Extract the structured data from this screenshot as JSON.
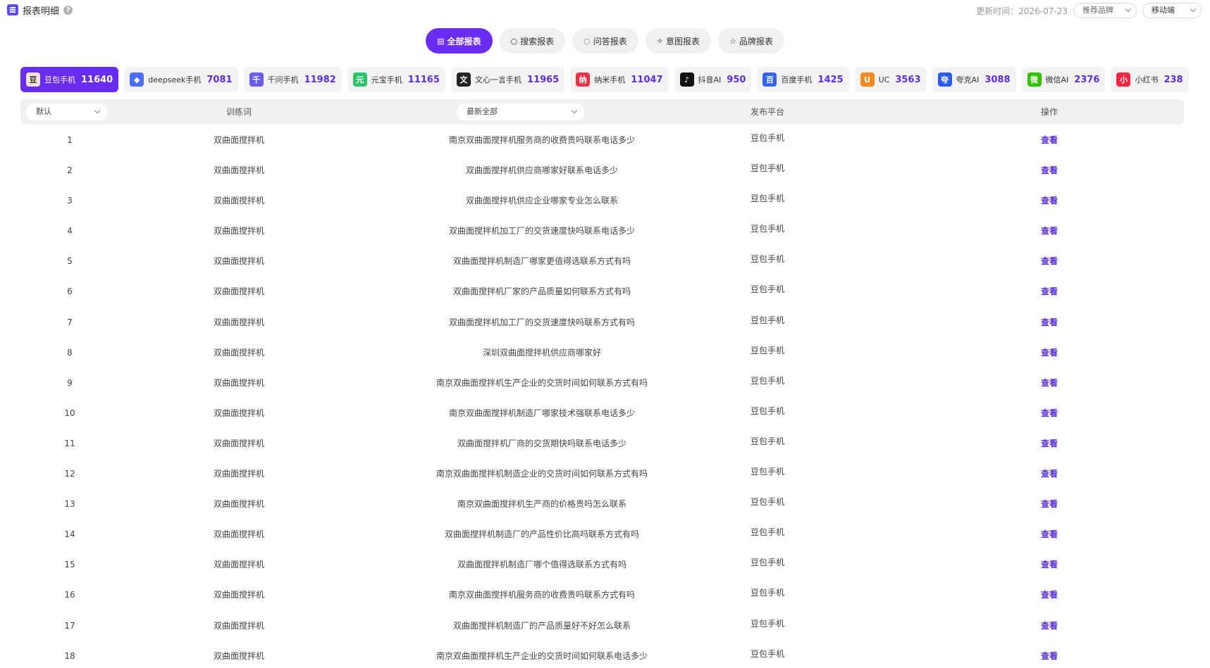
{
  "header": {
    "title": "报表明细",
    "help": "?",
    "update_time": "更新时间：2026-07-23",
    "brand_select": "推荐品牌",
    "device_select": "移动端"
  },
  "report_tabs": [
    {
      "label": "全部报表",
      "icon": "doc-icon",
      "glyph": "▤"
    },
    {
      "label": "搜索报表",
      "icon": "search-icon",
      "glyph": "○"
    },
    {
      "label": "问答报表",
      "icon": "chat-icon",
      "glyph": "◌"
    },
    {
      "label": "意图报表",
      "icon": "sparkle-icon",
      "glyph": "✧"
    },
    {
      "label": "品牌报表",
      "icon": "star-icon",
      "glyph": "☆"
    }
  ],
  "platforms": [
    {
      "name": "豆包手机",
      "count": "11640",
      "color": "#f3e6d8",
      "glyph": "豆"
    },
    {
      "name": "deepseek手机",
      "count": "7081",
      "color": "#4d6bfe",
      "glyph": "◆"
    },
    {
      "name": "千问手机",
      "count": "11982",
      "color": "#6b5cf5",
      "glyph": "千"
    },
    {
      "name": "元宝手机",
      "count": "11165",
      "color": "#2bc46b",
      "glyph": "元"
    },
    {
      "name": "文心一言手机",
      "count": "11965",
      "color": "#222222",
      "glyph": "文"
    },
    {
      "name": "纳米手机",
      "count": "11047",
      "color": "#e8334a",
      "glyph": "纳"
    },
    {
      "name": "抖音AI",
      "count": "950",
      "color": "#111111",
      "glyph": "♪"
    },
    {
      "name": "百度手机",
      "count": "1425",
      "color": "#3166f0",
      "glyph": "百"
    },
    {
      "name": "UC",
      "count": "3563",
      "color": "#f58a1f",
      "glyph": "U"
    },
    {
      "name": "夸克AI",
      "count": "3088",
      "color": "#2a5cf5",
      "glyph": "夸"
    },
    {
      "name": "微信AI",
      "count": "2376",
      "color": "#2dc100",
      "glyph": "微"
    },
    {
      "name": "小红书",
      "count": "238",
      "color": "#ff2442",
      "glyph": "小"
    }
  ],
  "table": {
    "sort_select": "默认",
    "col_word": "训练词",
    "filter_select": "最新全部",
    "col_platform": "发布平台",
    "col_action": "操作",
    "rows": [
      {
        "idx": "1",
        "word": "双曲面搅拌机",
        "question": "南京双曲面搅拌机服务商的收费贵吗联系电话多少",
        "platform": "豆包手机",
        "action": "查看"
      },
      {
        "idx": "2",
        "word": "双曲面搅拌机",
        "question": "双曲面搅拌机供应商哪家好联系电话多少",
        "platform": "豆包手机",
        "action": "查看"
      },
      {
        "idx": "3",
        "word": "双曲面搅拌机",
        "question": "双曲面搅拌机供应企业哪家专业怎么联系",
        "platform": "豆包手机",
        "action": "查看"
      },
      {
        "idx": "4",
        "word": "双曲面搅拌机",
        "question": "双曲面搅拌机加工厂的交货速度快吗联系电话多少",
        "platform": "豆包手机",
        "action": "查看"
      },
      {
        "idx": "5",
        "word": "双曲面搅拌机",
        "question": "双曲面搅拌机制造厂哪家更值得选联系方式有吗",
        "platform": "豆包手机",
        "action": "查看"
      },
      {
        "idx": "6",
        "word": "双曲面搅拌机",
        "question": "双曲面搅拌机厂家的产品质量如何联系方式有吗",
        "platform": "豆包手机",
        "action": "查看"
      },
      {
        "idx": "7",
        "word": "双曲面搅拌机",
        "question": "双曲面搅拌机加工厂的交货速度快吗联系方式有吗",
        "platform": "豆包手机",
        "action": "查看"
      },
      {
        "idx": "8",
        "word": "双曲面搅拌机",
        "question": "深圳双曲面搅拌机供应商哪家好",
        "platform": "豆包手机",
        "action": "查看"
      },
      {
        "idx": "9",
        "word": "双曲面搅拌机",
        "question": "南京双曲面搅拌机生产企业的交货时间如何联系方式有吗",
        "platform": "豆包手机",
        "action": "查看"
      },
      {
        "idx": "10",
        "word": "双曲面搅拌机",
        "question": "南京双曲面搅拌机制造厂哪家技术强联系电话多少",
        "platform": "豆包手机",
        "action": "查看"
      },
      {
        "idx": "11",
        "word": "双曲面搅拌机",
        "question": "双曲面搅拌机厂商的交货期快吗联系电话多少",
        "platform": "豆包手机",
        "action": "查看"
      },
      {
        "idx": "12",
        "word": "双曲面搅拌机",
        "question": "南京双曲面搅拌机制造企业的交货时间如何联系方式有吗",
        "platform": "豆包手机",
        "action": "查看"
      },
      {
        "idx": "13",
        "word": "双曲面搅拌机",
        "question": "南京双曲面搅拌机生产商的价格贵吗怎么联系",
        "platform": "豆包手机",
        "action": "查看"
      },
      {
        "idx": "14",
        "word": "双曲面搅拌机",
        "question": "双曲面搅拌机制造厂的产品性价比高吗联系方式有吗",
        "platform": "豆包手机",
        "action": "查看"
      },
      {
        "idx": "15",
        "word": "双曲面搅拌机",
        "question": "双曲面搅拌机制造厂哪个值得选联系方式有吗",
        "platform": "豆包手机",
        "action": "查看"
      },
      {
        "idx": "16",
        "word": "双曲面搅拌机",
        "question": "南京双曲面搅拌机服务商的收费贵吗联系方式有吗",
        "platform": "豆包手机",
        "action": "查看"
      },
      {
        "idx": "17",
        "word": "双曲面搅拌机",
        "question": "双曲面搅拌机制造厂的产品质量好不好怎么联系",
        "platform": "豆包手机",
        "action": "查看"
      },
      {
        "idx": "18",
        "word": "双曲面搅拌机",
        "question": "南京双曲面搅拌机生产企业的交货时间如何联系电话多少",
        "platform": "豆包手机",
        "action": "查看"
      }
    ]
  }
}
